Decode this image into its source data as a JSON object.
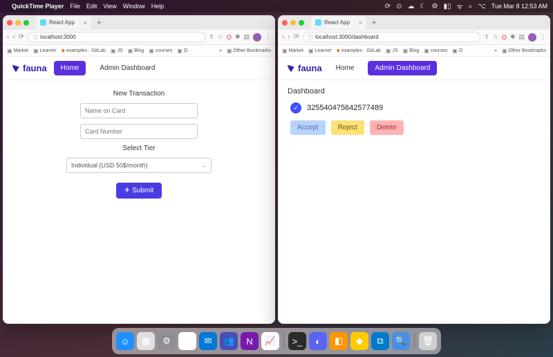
{
  "menubar": {
    "app": "QuickTime Player",
    "items": [
      "File",
      "Edit",
      "View",
      "Window",
      "Help"
    ],
    "clock": "Tue Mar 8  12:53 AM"
  },
  "leftWindow": {
    "tabTitle": "React App",
    "url": "localhost:3000",
    "bookmarks": [
      "Market",
      "Learner",
      "examples · GitLab",
      "JS",
      "Blog",
      "courses",
      "O"
    ],
    "otherBookmarks": "Other Bookmarks",
    "brand": "fauna",
    "nav": {
      "home": "Home",
      "admin": "Admin Dashboard"
    },
    "form": {
      "title": "New Transaction",
      "namePh": "Name on Card",
      "cardPh": "Card Number",
      "tierLabel": "Select Tier",
      "tierValue": "Individual (USD 50$/month)",
      "submit": "Submit"
    }
  },
  "rightWindow": {
    "tabTitle": "React App",
    "url": "localhost:3000/dashboard",
    "bookmarks": [
      "Market",
      "Learner",
      "examples · GitLab",
      "JS",
      "Blog",
      "courses",
      "O"
    ],
    "otherBookmarks": "Other Bookmarks",
    "brand": "fauna",
    "nav": {
      "home": "Home",
      "admin": "Admin Dashboard"
    },
    "dash": {
      "title": "Dashboard",
      "txId": "325540475642577489",
      "accept": "Accept",
      "reject": "Reject",
      "delete": "Delete"
    }
  },
  "dock": {
    "apps": [
      {
        "name": "finder",
        "bg": "#1e90ff",
        "glyph": "☺"
      },
      {
        "name": "launchpad",
        "bg": "#e0e0e0",
        "glyph": "▦"
      },
      {
        "name": "settings",
        "bg": "#8e8e93",
        "glyph": "⚙"
      },
      {
        "name": "chrome",
        "bg": "#fff",
        "glyph": "◉"
      },
      {
        "name": "outlook",
        "bg": "#0078d4",
        "glyph": "✉"
      },
      {
        "name": "teams",
        "bg": "#464eb8",
        "glyph": "👥"
      },
      {
        "name": "onenote",
        "bg": "#7719aa",
        "glyph": "N"
      },
      {
        "name": "graph",
        "bg": "#fff",
        "glyph": "📈"
      },
      {
        "name": "terminal",
        "bg": "#2b2b2b",
        "glyph": ">_"
      },
      {
        "name": "discord",
        "bg": "#5865f2",
        "glyph": "◐"
      },
      {
        "name": "app1",
        "bg": "#ff9500",
        "glyph": "◧"
      },
      {
        "name": "app2",
        "bg": "#ffcc00",
        "glyph": "◆"
      },
      {
        "name": "vscode",
        "bg": "#007acc",
        "glyph": "⧉"
      },
      {
        "name": "preview",
        "bg": "#4a90e2",
        "glyph": "🔍"
      },
      {
        "name": "trash",
        "bg": "#d0d0d0",
        "glyph": "🗑"
      }
    ]
  }
}
